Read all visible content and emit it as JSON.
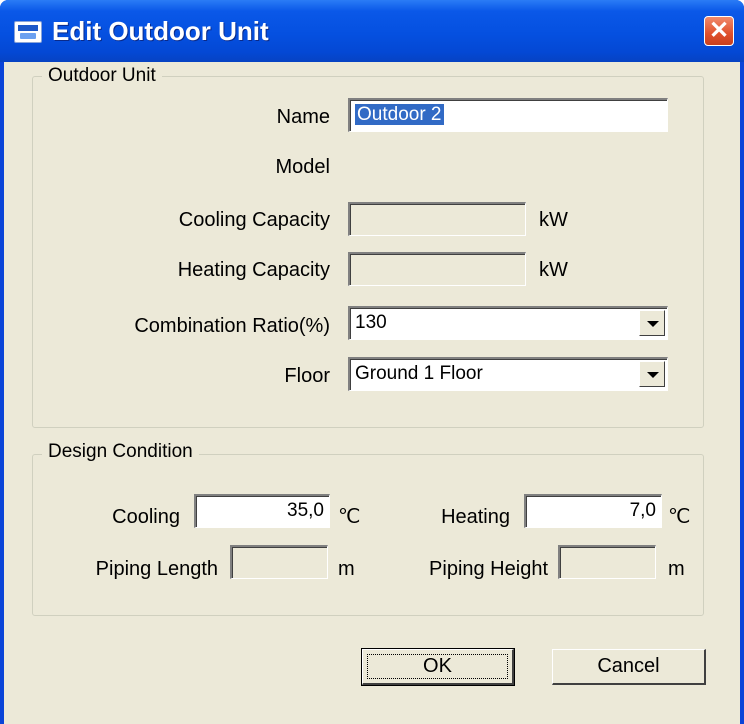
{
  "window": {
    "title": "Edit Outdoor Unit",
    "close_glyph": "✕"
  },
  "outdoor_unit": {
    "group_label": "Outdoor Unit",
    "name_label": "Name",
    "name_value": "Outdoor  2",
    "model_label": "Model",
    "cooling_capacity_label": "Cooling Capacity",
    "cooling_capacity_value": "",
    "cooling_capacity_unit": "kW",
    "heating_capacity_label": "Heating Capacity",
    "heating_capacity_value": "",
    "heating_capacity_unit": "kW",
    "combination_ratio_label": "Combination Ratio(%)",
    "combination_ratio_value": "130",
    "floor_label": "Floor",
    "floor_value": "Ground  1 Floor"
  },
  "design_condition": {
    "group_label": "Design Condition",
    "cooling_label": "Cooling",
    "cooling_value": "35,0",
    "cooling_unit": "℃",
    "heating_label": "Heating",
    "heating_value": "7,0",
    "heating_unit": "℃",
    "piping_length_label": "Piping Length",
    "piping_length_value": "",
    "piping_length_unit": "m",
    "piping_height_label": "Piping Height",
    "piping_height_value": "",
    "piping_height_unit": "m"
  },
  "buttons": {
    "ok": "OK",
    "cancel": "Cancel"
  },
  "colors": {
    "titlebar": "#0550e0",
    "dialog_bg": "#ece9d8",
    "selection": "#316ac5",
    "close_button": "#e0502c"
  },
  "icons": {
    "app": "app-window-icon",
    "close": "close-icon",
    "dropdown": "chevron-down-icon"
  }
}
